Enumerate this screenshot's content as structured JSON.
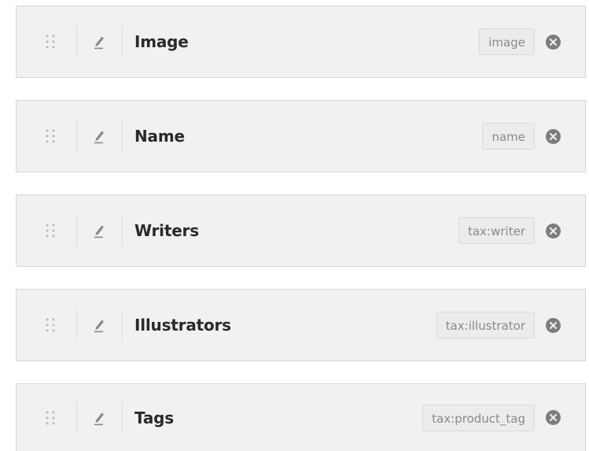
{
  "fields": [
    {
      "label": "Image",
      "key": "image"
    },
    {
      "label": "Name",
      "key": "name"
    },
    {
      "label": "Writers",
      "key": "tax:writer"
    },
    {
      "label": "Illustrators",
      "key": "tax:illustrator"
    },
    {
      "label": "Tags",
      "key": "tax:product_tag"
    }
  ],
  "icons": {
    "drag": "drag-handle-icon",
    "edit": "pencil-icon",
    "remove": "close-circle-icon"
  },
  "colors": {
    "row_bg": "#f1f1f1",
    "border": "#d6d6d6",
    "label": "#2a2a2a",
    "key_text": "#8a8a8a",
    "remove_bg": "#7d7d7d"
  }
}
